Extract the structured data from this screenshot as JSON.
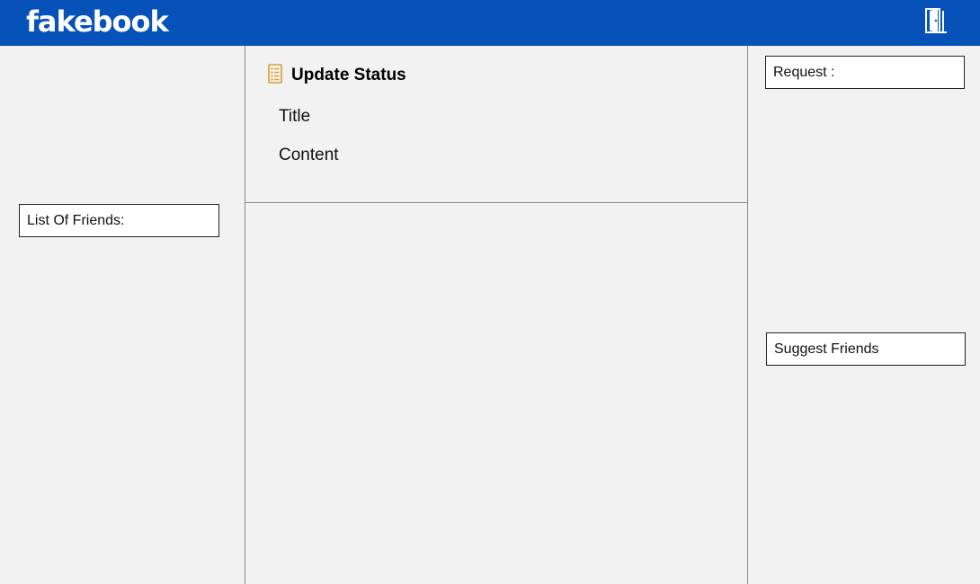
{
  "app": {
    "logo": "fakebook",
    "logout_icon": "door-exit-icon"
  },
  "left": {
    "friends_label": "List Of Friends:"
  },
  "center": {
    "status": {
      "icon": "checklist-document-icon",
      "icon_color": "#d9a02c",
      "heading": "Update Status",
      "title_label": "Title",
      "content_label": "Content"
    }
  },
  "right": {
    "request_label": "Request :",
    "suggest_label": "Suggest Friends"
  },
  "colors": {
    "topbar": "#0652b9",
    "background": "#f2f2f2"
  }
}
